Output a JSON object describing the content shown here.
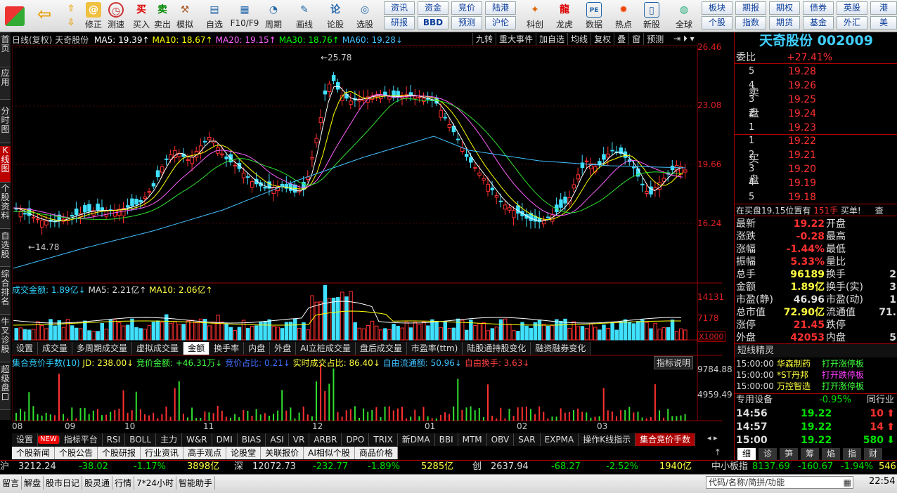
{
  "toolbar": {
    "left": [
      "修正",
      "测速",
      "买入",
      "卖出",
      "模拟",
      "自选",
      "F10/F9",
      "周期",
      "画线",
      "论股",
      "选股"
    ],
    "btns_row1": [
      "资讯",
      "资金",
      "竞价",
      "陆港"
    ],
    "btns_row2": [
      "研报",
      "BBD",
      "预测",
      "沪伦"
    ],
    "mid": [
      "科创",
      "龙虎",
      "数据",
      "热点",
      "新股"
    ],
    "globe": "全球",
    "btns2_row1": [
      "板块",
      "期报",
      "期权",
      "债券",
      "英股",
      "港"
    ],
    "btns2_row2": [
      "个股",
      "指数",
      "期货",
      "基金",
      "外汇",
      "美"
    ]
  },
  "lefttabs": [
    "首页",
    "应用",
    "分时图",
    "K线图",
    "个股资料",
    "自选股",
    "综合排名",
    "牛叉诊股",
    "超级盘口"
  ],
  "kline": {
    "header_prefix": "日线(复权)",
    "name": "天奇股份",
    "ma": [
      {
        "label": "MA5: 19.39↑",
        "color": "#ffffff"
      },
      {
        "label": "MA10: 18.67↑",
        "color": "#ffff00"
      },
      {
        "label": "MA20: 19.15↑",
        "color": "#ff60ff"
      },
      {
        "label": "MA30: 18.76↑",
        "color": "#00ff00"
      },
      {
        "label": "MA60: 19.28↓",
        "color": "#40c0ff"
      }
    ],
    "top_menu": [
      "九转",
      "重大事件",
      "加自选",
      "均线",
      "复权",
      "叠",
      "窗",
      "预测"
    ],
    "yticks": [
      "26.46",
      "23.08",
      "19.66",
      "16.24"
    ],
    "high_label": "25.78",
    "low_label": "14.78"
  },
  "volume": {
    "title": "成交金额: 1.89亿↓",
    "ma5": "MA5: 2.21亿↑",
    "ma10": "MA10: 2.06亿↑",
    "yticks": [
      "14131",
      "7178"
    ],
    "unit": "X1000"
  },
  "tabs1": [
    "设置",
    "成交量",
    "多周期成交量",
    "虚拟成交量",
    "金额",
    "换手率",
    "内盘",
    "外盘",
    "AI立桩成交量",
    "盘后成交量",
    "市盈率(ttm)",
    "陆股通持股变化",
    "融资融券变化"
  ],
  "indicator": {
    "title": "集合竞价手数(10)",
    "jd": "JD: 238.00↓",
    "jjje": "竞价金额: +46.31万↓",
    "jjzb": "竞价占比: 0.21↓",
    "sszb": "实时成交占比: 86.40↓",
    "zyltg": "自由流通额: 50.96↓",
    "zyhs": "自由换手: 3.63↓",
    "explain": "指标说明",
    "yticks": [
      "9784.88",
      "4959.49"
    ]
  },
  "months": [
    "08",
    "09",
    "10",
    "11",
    "12",
    "01",
    "02",
    "03"
  ],
  "tabs2": [
    "设置",
    "NEW",
    "指标平台",
    "RSI",
    "BOLL",
    "主力",
    "W&R",
    "DMI",
    "BIAS",
    "ASI",
    "VR",
    "ARBR",
    "DPO",
    "TRIX",
    "新DMA",
    "BBI",
    "MTM",
    "OBV",
    "SAR",
    "EXPMA",
    "操作K线指示",
    "集合竞价手数"
  ],
  "tabs3": [
    "个股新闻",
    "个股公告",
    "个股研报",
    "行业资讯",
    "高手观点",
    "论股堂",
    "关联报价",
    "AI相似个股",
    "商品价格"
  ],
  "right": {
    "title": "天奇股份 002009",
    "weibi_label": "委比",
    "weibi": "+27.41%",
    "sell": [
      [
        "5",
        "19.28"
      ],
      [
        "4",
        "19.26"
      ],
      [
        "3",
        "19.25"
      ],
      [
        "2",
        "19.24"
      ],
      [
        "1",
        "19.23"
      ]
    ],
    "buy": [
      [
        "1",
        "19.22"
      ],
      [
        "2",
        "19.21"
      ],
      [
        "3",
        "19.20"
      ],
      [
        "4",
        "19.19"
      ],
      [
        "5",
        "19.18"
      ]
    ],
    "sell_side": "卖盘",
    "buy_side": "买盘",
    "notice": "在买盘19.15位置有",
    "notice_vol": "151手",
    "notice_tail": "买单!",
    "notice_link": "查",
    "stats": [
      [
        "最新",
        "19.22",
        "red",
        "开盘",
        ""
      ],
      [
        "涨跌",
        "-0.28",
        "red",
        "最高",
        ""
      ],
      [
        "涨幅",
        "-1.44%",
        "red",
        "最低",
        ""
      ],
      [
        "振幅",
        "5.33%",
        "red",
        "量比",
        ""
      ],
      [
        "总手",
        "96189",
        "yel",
        "换手",
        "2"
      ],
      [
        "金额",
        "1.89亿",
        "yel",
        "换手(实)",
        "3"
      ],
      [
        "市盈(静)",
        "46.96",
        "wh",
        "市盈(动)",
        "1"
      ],
      [
        "总市值",
        "72.90亿",
        "yel",
        "流通值",
        "71."
      ],
      [
        "涨停",
        "21.45",
        "red",
        "跌停",
        ""
      ],
      [
        "外盘",
        "42053",
        "red",
        "内盘",
        "5"
      ]
    ],
    "short_title": "短线精灵",
    "short": [
      [
        "15:00:00",
        "华森制药",
        "打开涨停板"
      ],
      [
        "15:00:00",
        "*ST丹邦",
        "打开跌停板"
      ],
      [
        "15:00:00",
        "万控智造",
        "打开涨停板"
      ]
    ],
    "sector": "专用设备",
    "sector_chg": "-0.95%",
    "tongxing": "同行业",
    "ticks": [
      [
        "14:56",
        "19.22",
        "10",
        "up"
      ],
      [
        "14:57",
        "19.22",
        "14",
        "up"
      ],
      [
        "15:00",
        "19.22",
        "580",
        "down"
      ]
    ],
    "bottom_tabs": [
      "细",
      "诊",
      "笋",
      "筹",
      "焰",
      "指",
      "财"
    ]
  },
  "indexbar": [
    {
      "name": "沪",
      "val": "3212.24",
      "chg": "-38.02",
      "pct": "-1.17%",
      "amt": "3898亿"
    },
    {
      "name": "深",
      "val": "12072.73",
      "chg": "-232.77",
      "pct": "-1.89%",
      "amt": "5285亿"
    },
    {
      "name": "创",
      "val": "2637.94",
      "chg": "-68.27",
      "pct": "-2.52%",
      "amt": "1940亿"
    }
  ],
  "smallboard": {
    "name": "中小板指",
    "val": "8137.69",
    "chg": "-160.67",
    "pct": "-1.94%",
    "amt": "546"
  },
  "statusbar": {
    "items": [
      "留言",
      "解盘",
      "股市日记",
      "股灵通",
      "行情",
      "7*24小时",
      "智能助手"
    ],
    "search_placeholder": "代码/名称/简拼/功能",
    "time": "22:54"
  }
}
